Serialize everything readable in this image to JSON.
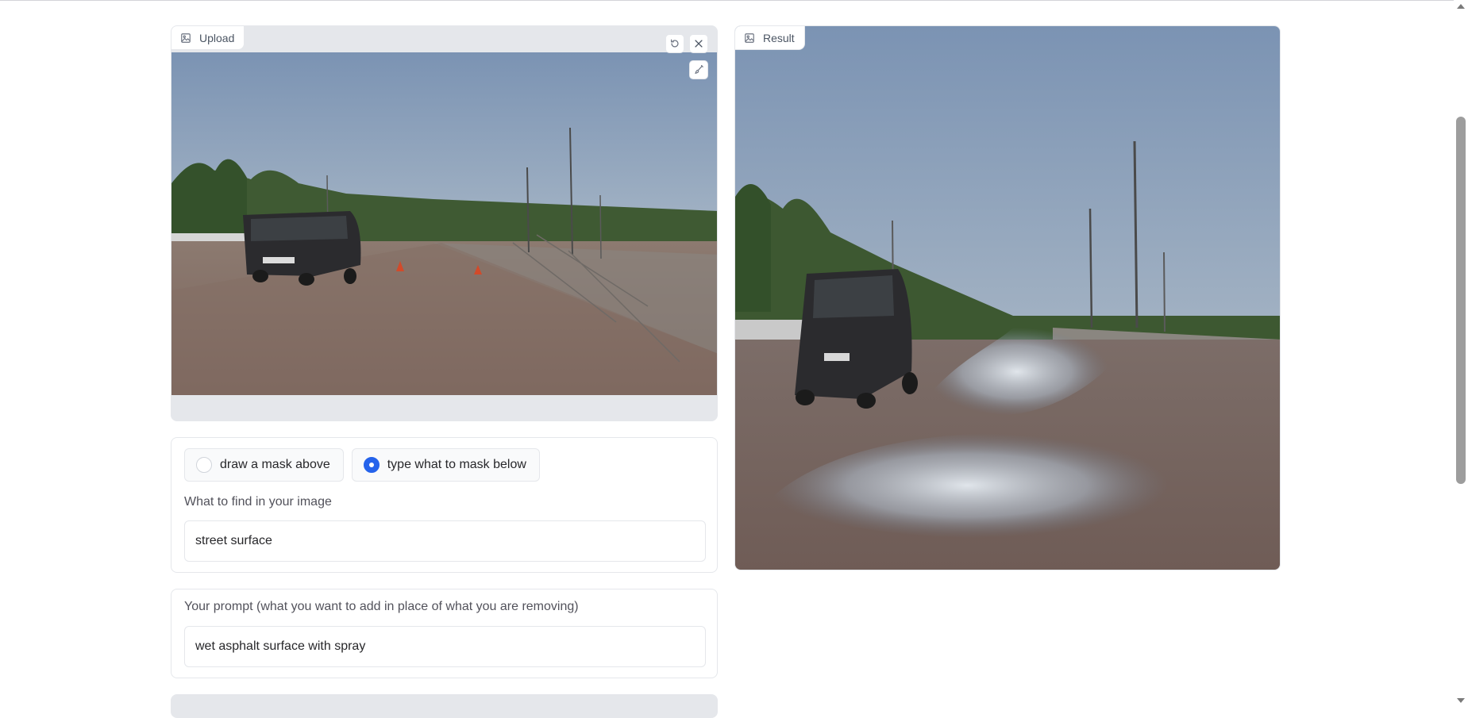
{
  "upload": {
    "label": "Upload",
    "icon": "image-icon",
    "brush_size_fraction": 0.28,
    "buttons": [
      "undo-icon",
      "close-icon",
      "brush-icon"
    ]
  },
  "result": {
    "label": "Result",
    "icon": "image-icon"
  },
  "mask_mode": {
    "options": [
      {
        "label": "draw a mask above",
        "checked": false
      },
      {
        "label": "type what to mask below",
        "checked": true
      }
    ]
  },
  "find": {
    "label": "What to find in your image",
    "value": "street surface"
  },
  "prompt": {
    "label": "Your prompt (what you want to add in place of what you are removing)",
    "value": "wet asphalt surface with spray"
  },
  "colors": {
    "accent": "#2563eb",
    "panel_bg": "#e5e7eb"
  }
}
